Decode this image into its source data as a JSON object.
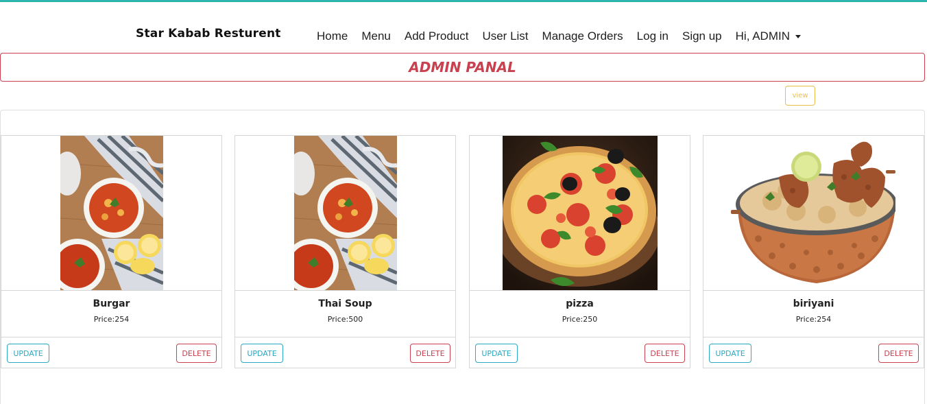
{
  "brand": "Star Kabab Resturent",
  "nav": {
    "home": "Home",
    "menu": "Menu",
    "add_product": "Add Product",
    "user_list": "User List",
    "manage_orders": "Manage Orders",
    "log_in": "Log in",
    "sign_up": "Sign up",
    "user_menu": "Hi, ADMIN"
  },
  "admin_title": "ADMIN PANAL",
  "view_label": "view",
  "products": [
    {
      "name": "Burgar",
      "price": "Price:254",
      "image": "soup-photo",
      "update_label": "UPDATE",
      "delete_label": "DELETE"
    },
    {
      "name": "Thai Soup",
      "price": "Price:500",
      "image": "soup-photo",
      "update_label": "UPDATE",
      "delete_label": "DELETE"
    },
    {
      "name": "pizza",
      "price": "Price:250",
      "image": "pizza-photo",
      "update_label": "UPDATE",
      "delete_label": "DELETE"
    },
    {
      "name": "biriyani",
      "price": "Price:254",
      "image": "biriyani-photo",
      "update_label": "UPDATE",
      "delete_label": "DELETE"
    }
  ],
  "colors": {
    "accent_top": "#2bb3ad",
    "danger": "#c9414f",
    "info": "#2aa8c4",
    "warning": "#e8be4b"
  }
}
